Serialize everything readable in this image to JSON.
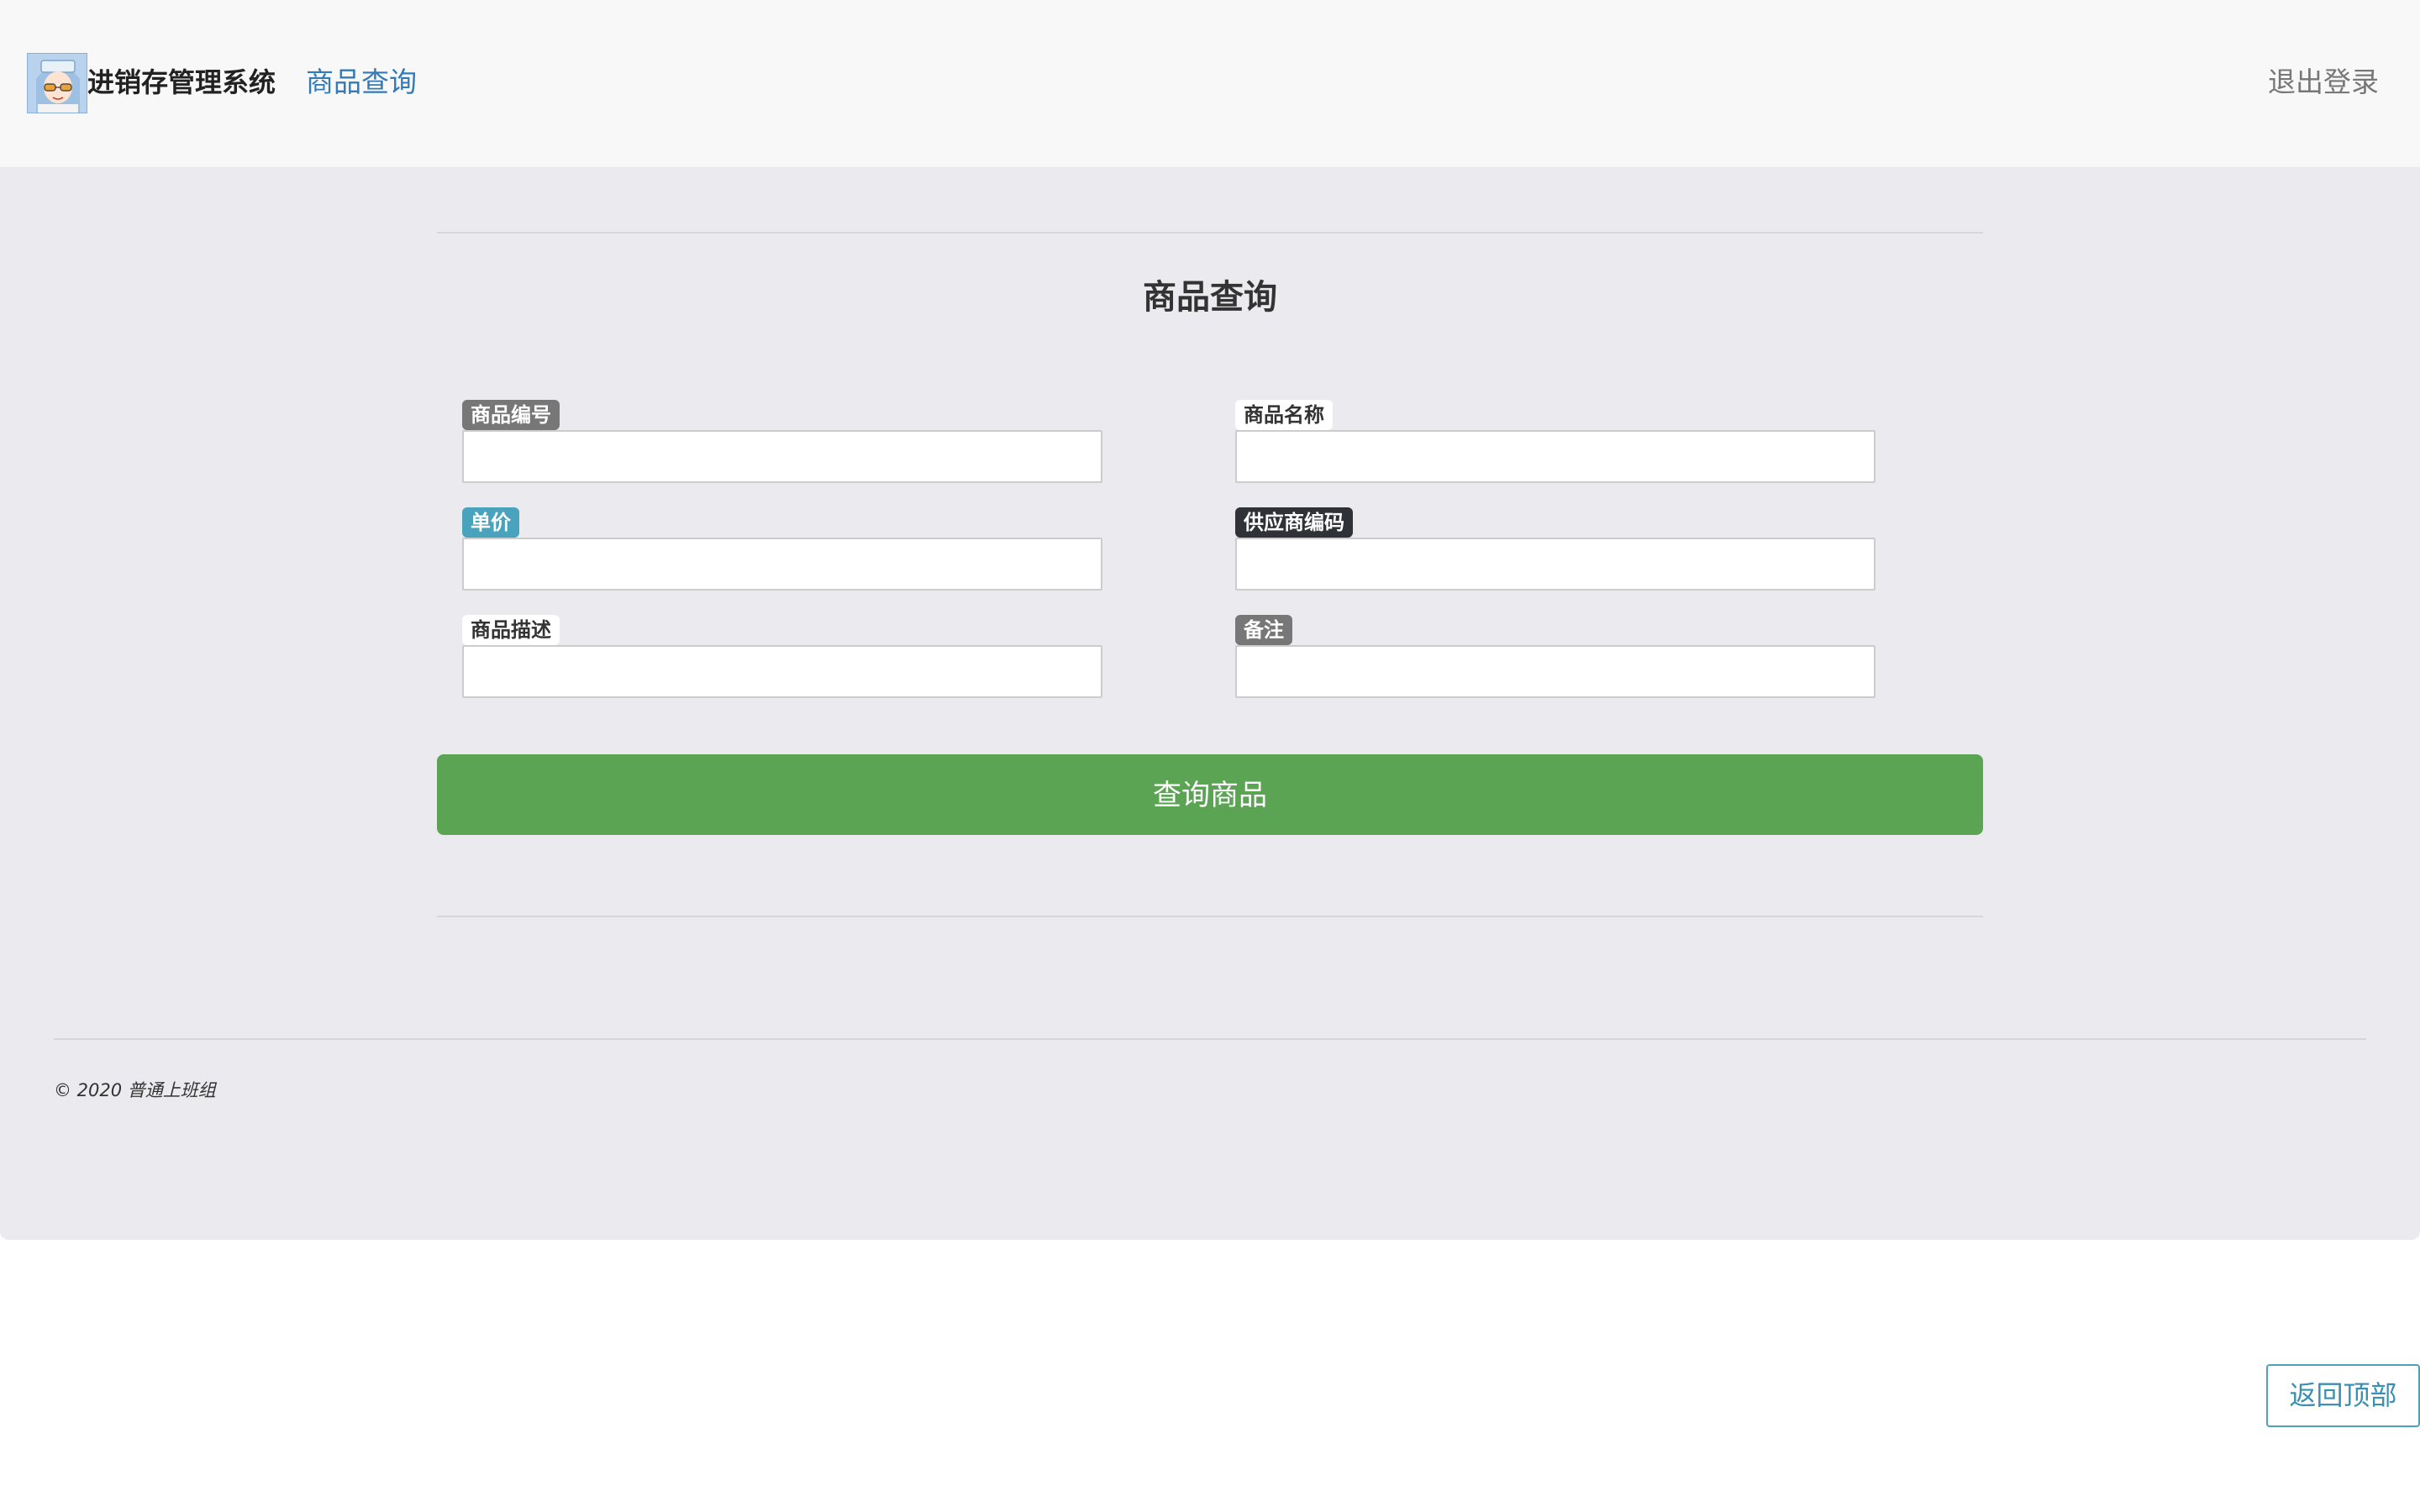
{
  "navbar": {
    "brand": "进销存管理系统",
    "nav_link": "商品查询",
    "logout": "退出登录"
  },
  "form": {
    "title": "商品查询",
    "fields": [
      {
        "label": "商品编号",
        "value": "",
        "placeholder": ""
      },
      {
        "label": "商品名称",
        "value": "",
        "placeholder": ""
      },
      {
        "label": "单价",
        "value": "",
        "placeholder": ""
      },
      {
        "label": "供应商编码",
        "value": "",
        "placeholder": ""
      },
      {
        "label": "商品描述",
        "value": "",
        "placeholder": ""
      },
      {
        "label": "备注",
        "value": "",
        "placeholder": ""
      }
    ],
    "submit_label": "查询商品"
  },
  "footer": {
    "copyright": "© 2020 普通上班组"
  },
  "back_to_top": "返回顶部",
  "colors": {
    "nav_link": "#337ab7",
    "submit_bg": "#5aa454",
    "page_bg": "#ebeaef",
    "navbar_bg": "#f8f8f8"
  },
  "icons": {
    "logo": "anime-avatar-logo"
  }
}
